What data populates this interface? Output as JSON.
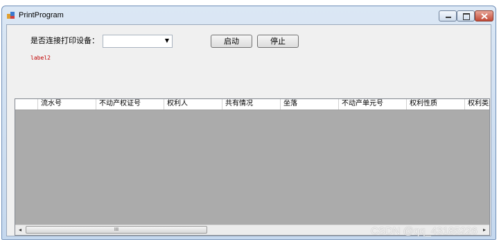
{
  "window": {
    "title": "PrintProgram",
    "controls": {
      "minimize_icon": "minimize-icon",
      "maximize_icon": "maximize-icon",
      "close_icon": "close-icon"
    }
  },
  "form": {
    "connect_label": "是否连接打印设备：",
    "combo_value": "",
    "start_button": "启动",
    "stop_button": "停止",
    "status_label": "label2"
  },
  "grid": {
    "columns": [
      "流水号",
      "不动产权证号",
      "权利人",
      "共有情况",
      "坐落",
      "不动产单元号",
      "权利性质",
      "权利类型"
    ],
    "rows": []
  },
  "scrollbar": {
    "left_arrow": "◂",
    "right_arrow": "▸",
    "thumb_grip": "III"
  },
  "watermark": "CSDN @qq_43185226",
  "colors": {
    "grid_background": "#ababab",
    "status_label": "#c00000"
  }
}
